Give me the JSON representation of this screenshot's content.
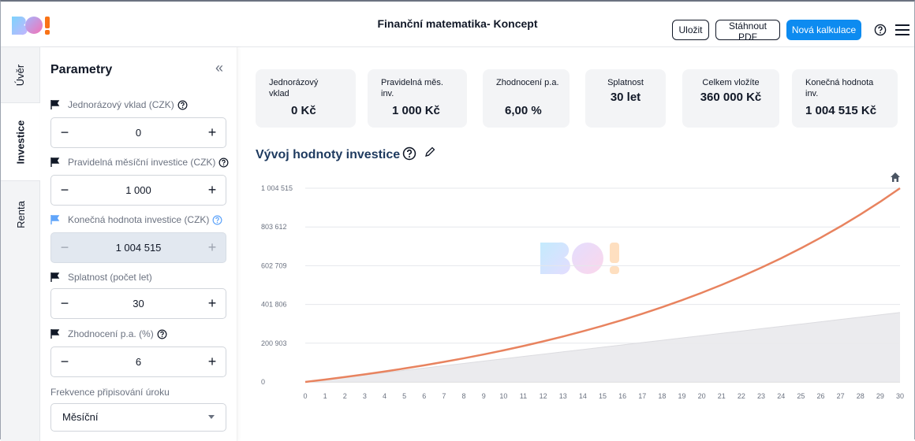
{
  "header": {
    "title": "Finanční matematika- Koncept",
    "save_label": "Uložit",
    "pdf_label": "Stáhnout PDF",
    "new_label": "Nová kalkulace",
    "logo_text": "BO!"
  },
  "side_tabs": [
    {
      "label": "Úvěr",
      "active": false
    },
    {
      "label": "Investice",
      "active": true
    },
    {
      "label": "Renta",
      "active": false
    }
  ],
  "params": {
    "title": "Parametry",
    "fields": [
      {
        "label": "Jednorázový vklad (CZK)",
        "value": "0",
        "has_help": true,
        "disabled": false
      },
      {
        "label": "Pravidelná měsíční investice (CZK)",
        "value": "1 000",
        "has_help": true,
        "disabled": false
      },
      {
        "label": "Konečná hodnota investice (CZK)",
        "value": "1 004 515",
        "has_help": true,
        "disabled": true
      },
      {
        "label": "Splatnost (počet let)",
        "value": "30",
        "has_help": false,
        "disabled": false
      },
      {
        "label": "Zhodnocení p.a. (%)",
        "value": "6",
        "has_help": true,
        "disabled": false
      }
    ],
    "frequency": {
      "label": "Frekvence připisování úroku",
      "value": "Měsíční"
    }
  },
  "summary": [
    {
      "label": "Jednorázový vklad",
      "value": "0 Kč"
    },
    {
      "label": "Pravidelná měs. inv.",
      "value": "1 000 Kč"
    },
    {
      "label": "Zhodnocení p.a.",
      "value": "6,00 %"
    },
    {
      "label": "Splatnost",
      "value": "30 let"
    },
    {
      "label": "Celkem vložíte",
      "value": "360 000 Kč"
    },
    {
      "label": "Konečná hodnota inv.",
      "value": "1 004 515 Kč"
    }
  ],
  "chart_title": "Vývoj hodnoty investice",
  "colors": {
    "accent": "#0d8bf0",
    "value_line": "#e8835f",
    "deposits_area": "#e9e9ec",
    "heading": "#1e3a5f"
  },
  "chart_data": {
    "type": "area",
    "x": [
      0,
      1,
      2,
      3,
      4,
      5,
      6,
      7,
      8,
      9,
      10,
      11,
      12,
      13,
      14,
      15,
      16,
      17,
      18,
      19,
      20,
      21,
      22,
      23,
      24,
      25,
      26,
      27,
      28,
      29,
      30
    ],
    "y_ticks": [
      "0",
      "200 903",
      "401 806",
      "602 709",
      "803 612",
      "1 004 515"
    ],
    "ylim": [
      0,
      1004515
    ],
    "series": [
      {
        "values": [
          0,
          12336,
          25428,
          39329,
          54085,
          69751,
          86384,
          104040,
          122785,
          142686,
          163879,
          186337,
          210223,
          235574,
          262487,
          291060,
          321395,
          353601,
          387790,
          424088,
          462387,
          503307,
          546584,
          592529,
          641306,
          693091,
          748066,
          806430,
          868389,
          934168,
          1004515
        ]
      },
      {
        "values": [
          0,
          12000,
          24000,
          36000,
          48000,
          60000,
          72000,
          84000,
          96000,
          108000,
          120000,
          132000,
          144000,
          156000,
          168000,
          180000,
          192000,
          204000,
          216000,
          228000,
          240000,
          252000,
          264000,
          276000,
          288000,
          300000,
          312000,
          324000,
          336000,
          348000,
          360000
        ]
      }
    ],
    "grid": true
  }
}
